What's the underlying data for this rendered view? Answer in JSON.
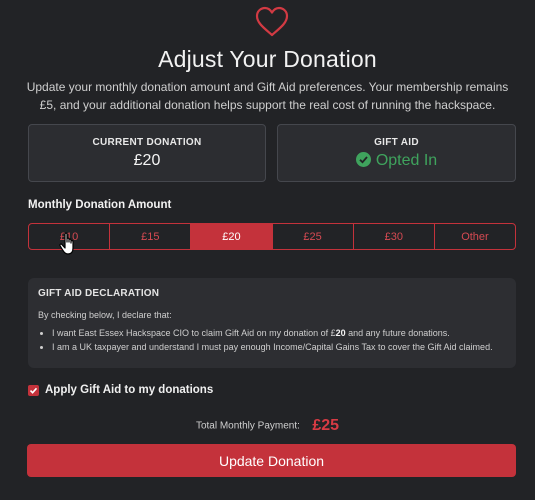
{
  "header": {
    "title": "Adjust Your Donation",
    "subtitle": "Update your monthly donation amount and Gift Aid preferences. Your membership remains £5, and your additional donation helps support the real cost of running the hackspace."
  },
  "cards": {
    "current": {
      "label": "CURRENT DONATION",
      "value": "£20"
    },
    "gift_aid": {
      "label": "GIFT AID",
      "value": "Opted In"
    }
  },
  "amount": {
    "label": "Monthly Donation Amount",
    "options": [
      "£10",
      "£15",
      "£20",
      "£25",
      "£30",
      "Other"
    ],
    "selected": "£20"
  },
  "declaration": {
    "title": "GIFT AID DECLARATION",
    "intro": "By checking below, I declare that:",
    "item1_before": "I want East Essex Hackspace CIO to claim Gift Aid on my donation of £",
    "item1_amount": "20",
    "item1_after": " and any future donations.",
    "item2": "I am a UK taxpayer and understand I must pay enough Income/Capital Gains Tax to cover the Gift Aid claimed."
  },
  "checkbox": {
    "label": "Apply Gift Aid to my donations",
    "checked": true
  },
  "total": {
    "label": "Total Monthly Payment:",
    "value": "£25"
  },
  "submit": {
    "label": "Update Donation"
  },
  "colors": {
    "accent": "#c4323b",
    "success": "#3fa35d",
    "background": "#222326"
  },
  "icons": {
    "header": "heart-icon",
    "status": "check-circle-icon",
    "pointer": "hand-cursor-icon"
  }
}
